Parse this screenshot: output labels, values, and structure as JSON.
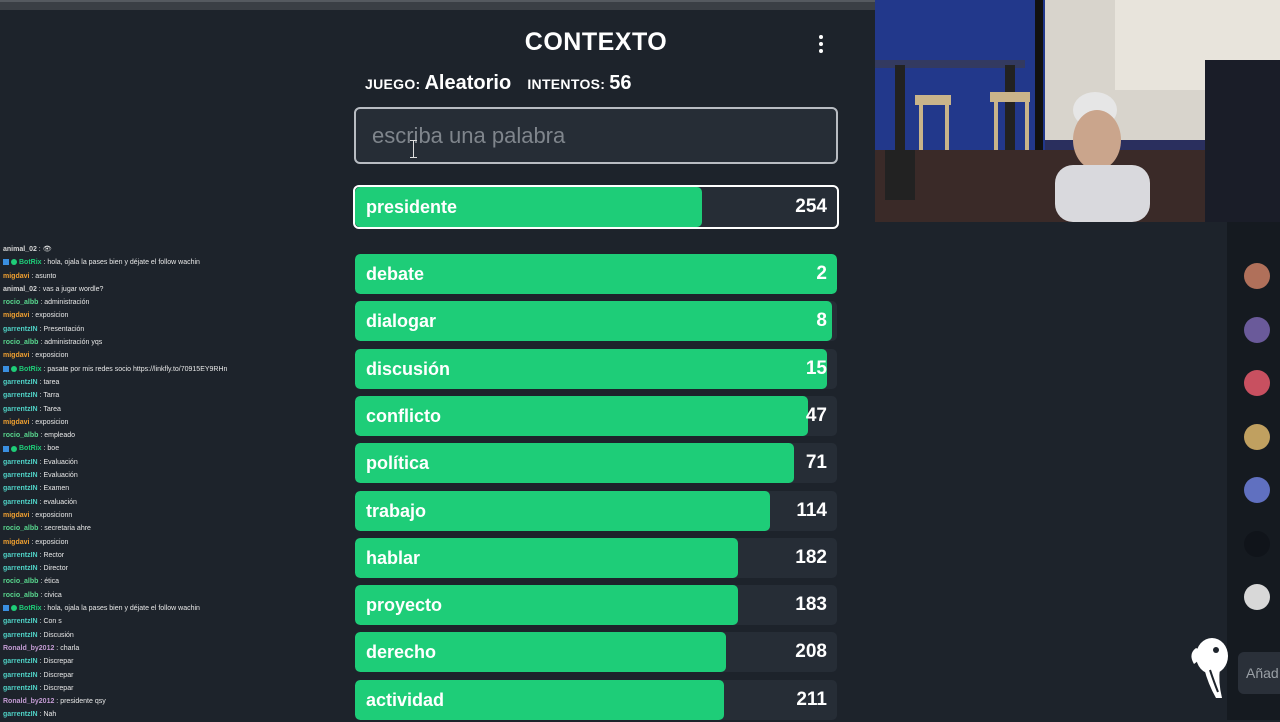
{
  "header": {
    "title": "CONTEXTO"
  },
  "stats": {
    "game_label": "JUEGO:",
    "game_value": "Aleatorio",
    "attempts_label": "INTENTOS:",
    "attempts_value": "56"
  },
  "input": {
    "placeholder": "escriba una palabra",
    "value": ""
  },
  "current_guess": {
    "word": "presidente",
    "rank": "254",
    "fill": 0.72
  },
  "guesses": [
    {
      "word": "debate",
      "rank": "2",
      "fill": 1.0
    },
    {
      "word": "dialogar",
      "rank": "8",
      "fill": 0.99
    },
    {
      "word": "discusión",
      "rank": "15",
      "fill": 0.98
    },
    {
      "word": "conflicto",
      "rank": "47",
      "fill": 0.94
    },
    {
      "word": "política",
      "rank": "71",
      "fill": 0.91
    },
    {
      "word": "trabajo",
      "rank": "114",
      "fill": 0.86
    },
    {
      "word": "hablar",
      "rank": "182",
      "fill": 0.795
    },
    {
      "word": "proyecto",
      "rank": "183",
      "fill": 0.795
    },
    {
      "word": "derecho",
      "rank": "208",
      "fill": 0.77
    },
    {
      "word": "actividad",
      "rank": "211",
      "fill": 0.765
    }
  ],
  "chat": [
    {
      "user": "animal_02",
      "color": "#d4d4d4",
      "msg": "👁",
      "badges": []
    },
    {
      "user": "BotRix",
      "color": "#1ecd78",
      "msg": "hola, ojala la pases bien y déjate el follow wachin",
      "badges": [
        "box",
        "dot"
      ]
    },
    {
      "user": "migdavi",
      "color": "#f0a030",
      "msg": "asunto",
      "badges": []
    },
    {
      "user": "animal_02",
      "color": "#d4d4d4",
      "msg": "vas a jugar wordle?",
      "badges": []
    },
    {
      "user": "rocio_albb",
      "color": "#58d68d",
      "msg": "administración",
      "badges": []
    },
    {
      "user": "migdavi",
      "color": "#f0a030",
      "msg": "exposicion",
      "badges": []
    },
    {
      "user": "garrentzIN",
      "color": "#4fd1c5",
      "msg": "Presentación",
      "badges": []
    },
    {
      "user": "rocio_albb",
      "color": "#58d68d",
      "msg": "administración yqs",
      "badges": []
    },
    {
      "user": "migdavi",
      "color": "#f0a030",
      "msg": "exposicion",
      "badges": []
    },
    {
      "user": "BotRix",
      "color": "#1ecd78",
      "msg": "pasate por mis redes socio https://linkfly.to/70915EY9RHn",
      "badges": [
        "box",
        "dot"
      ]
    },
    {
      "user": "garrentzIN",
      "color": "#4fd1c5",
      "msg": "tarea",
      "badges": []
    },
    {
      "user": "garrentzIN",
      "color": "#4fd1c5",
      "msg": "Tarra",
      "badges": []
    },
    {
      "user": "garrentzIN",
      "color": "#4fd1c5",
      "msg": "Tarea",
      "badges": []
    },
    {
      "user": "migdavi",
      "color": "#f0a030",
      "msg": "exposicion",
      "badges": []
    },
    {
      "user": "rocio_albb",
      "color": "#58d68d",
      "msg": "empleado",
      "badges": []
    },
    {
      "user": "BotRix",
      "color": "#1ecd78",
      "msg": "boe",
      "badges": [
        "box",
        "dot"
      ]
    },
    {
      "user": "garrentzIN",
      "color": "#4fd1c5",
      "msg": "Evaluación",
      "badges": []
    },
    {
      "user": "garrentzIN",
      "color": "#4fd1c5",
      "msg": "Evaluación",
      "badges": []
    },
    {
      "user": "garrentzIN",
      "color": "#4fd1c5",
      "msg": "Examen",
      "badges": []
    },
    {
      "user": "garrentzIN",
      "color": "#4fd1c5",
      "msg": "evaluación",
      "badges": []
    },
    {
      "user": "migdavi",
      "color": "#f0a030",
      "msg": "exposicionn",
      "badges": []
    },
    {
      "user": "rocio_albb",
      "color": "#58d68d",
      "msg": "secretaria ahre",
      "badges": []
    },
    {
      "user": "migdavi",
      "color": "#f0a030",
      "msg": "exposicion",
      "badges": []
    },
    {
      "user": "garrentzIN",
      "color": "#4fd1c5",
      "msg": "Rector",
      "badges": []
    },
    {
      "user": "garrentzIN",
      "color": "#4fd1c5",
      "msg": "Director",
      "badges": []
    },
    {
      "user": "rocio_albb",
      "color": "#58d68d",
      "msg": "ética",
      "badges": []
    },
    {
      "user": "rocio_albb",
      "color": "#58d68d",
      "msg": "civica",
      "badges": []
    },
    {
      "user": "BotRix",
      "color": "#1ecd78",
      "msg": "hola, ojala la pases bien y déjate el follow wachin",
      "badges": [
        "box",
        "dot"
      ]
    },
    {
      "user": "garrentzIN",
      "color": "#4fd1c5",
      "msg": "Con s",
      "badges": []
    },
    {
      "user": "garrentzIN",
      "color": "#4fd1c5",
      "msg": "Discusión",
      "badges": []
    },
    {
      "user": "Ronald_by2012",
      "color": "#c39bd3",
      "msg": "charla",
      "badges": []
    },
    {
      "user": "garrentzIN",
      "color": "#4fd1c5",
      "msg": "Discrepar",
      "badges": []
    },
    {
      "user": "garrentzIN",
      "color": "#4fd1c5",
      "msg": "Discrepar",
      "badges": []
    },
    {
      "user": "garrentzIN",
      "color": "#4fd1c5",
      "msg": "Discrepar",
      "badges": []
    },
    {
      "user": "Ronald_by2012",
      "color": "#c39bd3",
      "msg": "presidente qsy",
      "badges": []
    },
    {
      "user": "garrentzIN",
      "color": "#4fd1c5",
      "msg": "Nah",
      "badges": []
    }
  ],
  "side_panel": {
    "add_placeholder": "Añad",
    "avatars": [
      "#b0705a",
      "#6a5a9a",
      "#c85060",
      "#c0a060",
      "#6070c0",
      "#10141a",
      "#d8d8d8"
    ]
  },
  "colors": {
    "accent": "#1ecd78",
    "background": "#1d232b",
    "row_bg": "#262d36"
  }
}
